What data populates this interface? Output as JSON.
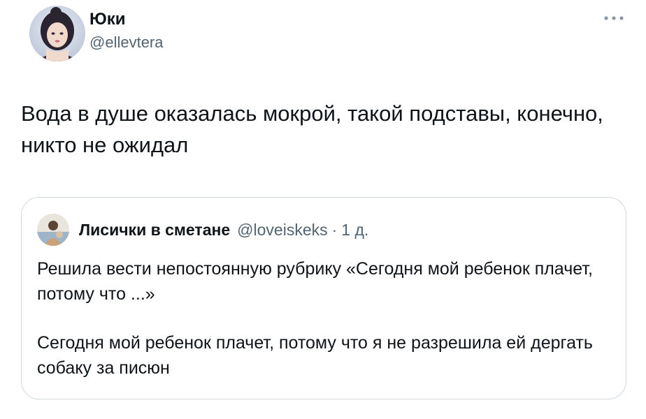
{
  "author": {
    "display_name": "Юки",
    "handle": "@ellevtera",
    "avatar_icon": "avatar-portrait"
  },
  "more_icon": "more-horizontal-icon",
  "tweet": {
    "text": "Вода в душе оказалась мокрой, такой подставы, конечно, никто не ожидал"
  },
  "quoted": {
    "display_name": "Лисички в сметане",
    "handle": "@loveiskeks",
    "separator": "·",
    "time": "1 д.",
    "avatar_icon": "avatar-photo",
    "paragraphs": [
      "Решила вести непостоянную рубрику «Сегодня мой ребенок плачет, потому что ...»",
      "Сегодня мой ребенок плачет, потому что я не разрешила ей дергать собаку за писюн"
    ]
  },
  "colors": {
    "text_primary": "#0f1419",
    "text_secondary": "#536471",
    "border": "#cfd9de"
  }
}
